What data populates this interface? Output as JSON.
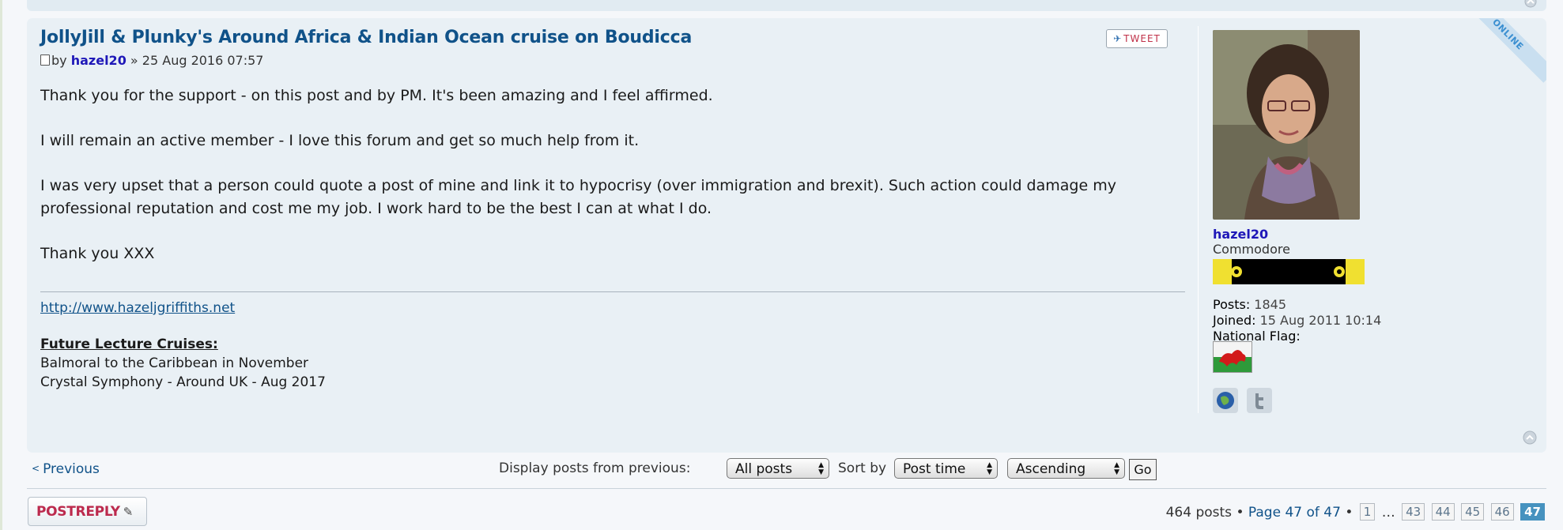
{
  "post": {
    "title": "JollyJill & Plunky's Around Africa & Indian Ocean cruise on Boudicca",
    "by_label": "by",
    "author": "hazel20",
    "date": "» 25 Aug 2016 07:57",
    "tweet_label": "TWEET",
    "paragraphs": [
      "Thank you for the support - on this post and by PM. It's been amazing and I feel affirmed.",
      "I will remain an active member - I love this forum and get so much help from it.",
      "I was very upset that a person could quote a post of mine and link it to hypocrisy (over immigration and brexit). Such action could damage my professional reputation and cost me my job. I work hard to be the best I can at what I do.",
      "Thank you XXX"
    ],
    "signature": {
      "link": "http://www.hazeljgriffiths.net",
      "heading": "Future Lecture Cruises:",
      "lines": [
        "Balmoral to the Caribbean in November",
        "Crystal Symphony - Around UK - Aug 2017"
      ]
    }
  },
  "profile": {
    "username": "hazel20",
    "rank": "Commodore",
    "online_label": "ONLINE",
    "posts_label": "Posts:",
    "posts_value": "1845",
    "joined_label": "Joined:",
    "joined_value": "15 Aug 2011 10:14",
    "flag_label": "National Flag:",
    "icons": [
      "website-icon",
      "twitter-icon"
    ]
  },
  "nav": {
    "previous": "Previous",
    "display_label": "Display posts from previous:",
    "display_value": "All posts",
    "sort_label": "Sort by",
    "sort_value": "Post time",
    "order_value": "Ascending",
    "go_label": "Go"
  },
  "footer": {
    "postreply": "POSTREPLY",
    "posts_count": "464 posts",
    "page_info": "Page 47 of 47",
    "pages": [
      "1",
      "…",
      "43",
      "44",
      "45",
      "46",
      "47"
    ],
    "current_page": "47"
  },
  "colors": {
    "link": "#105289",
    "username": "#1f18b8",
    "post_bg": "#e9f0f5",
    "postreply": "#bc2a4d",
    "active_page": "#4692bf"
  }
}
